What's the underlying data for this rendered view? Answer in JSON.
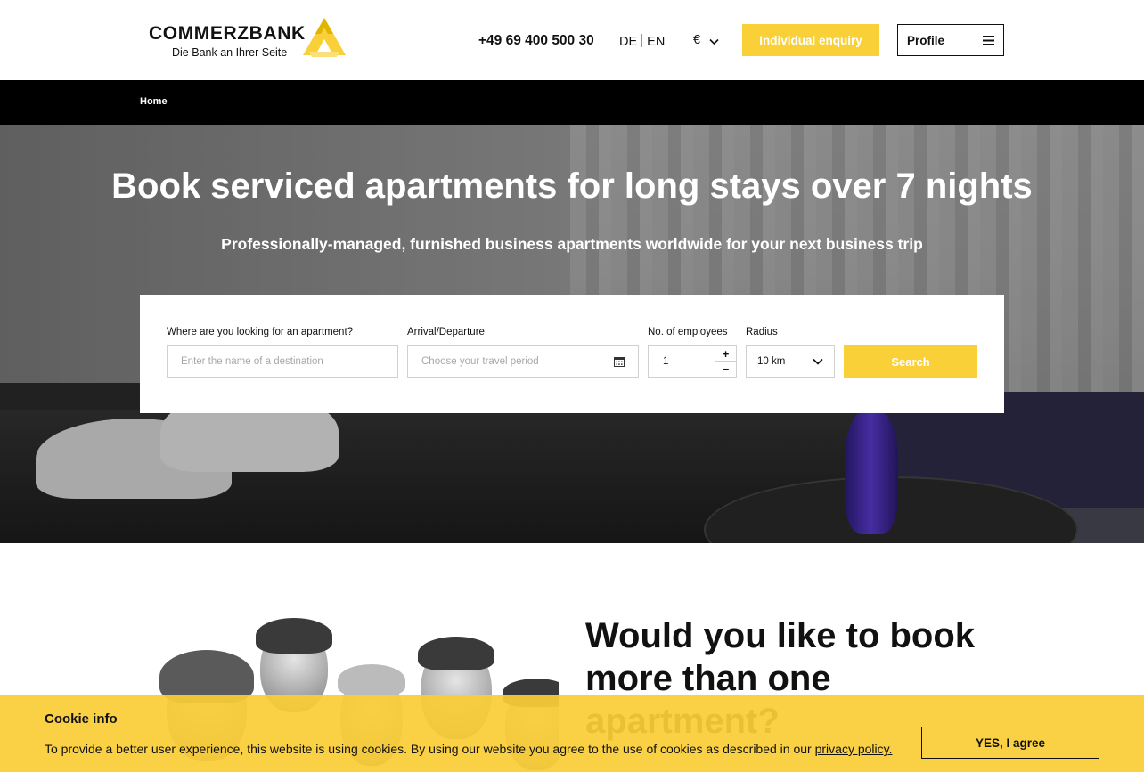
{
  "header": {
    "logo_word": "COMMERZBANK",
    "logo_tagline": "Die Bank an Ihrer Seite",
    "phone": "+49 69 400 500 30",
    "lang_de": "DE",
    "lang_en": "EN",
    "currency": "€",
    "enquiry_label": "Individual enquiry",
    "profile_label": "Profile",
    "brand_color": "#f9d038"
  },
  "breadcrumb": {
    "home": "Home"
  },
  "hero": {
    "title": "Book serviced apartments for long stays over 7 nights",
    "subtitle": "Professionally-managed, furnished business apartments worldwide for your next business trip"
  },
  "search": {
    "destination_label": "Where are you looking for an apartment?",
    "destination_placeholder": "Enter the name of a destination",
    "dates_label": "Arrival/Departure",
    "dates_placeholder": "Choose your travel period",
    "employees_label": "No. of employees",
    "employees_value": "1",
    "plus": "+",
    "minus": "−",
    "radius_label": "Radius",
    "radius_value": "10 km",
    "search_label": "Search"
  },
  "section": {
    "title": "Would you like to book more than one apartment?"
  },
  "cookie": {
    "title": "Cookie info",
    "text": "To provide a better user experience, this website is using cookies. By using our website you agree to the use of cookies as described in our",
    "link": "privacy policy.",
    "agree_label": "YES, I agree"
  }
}
